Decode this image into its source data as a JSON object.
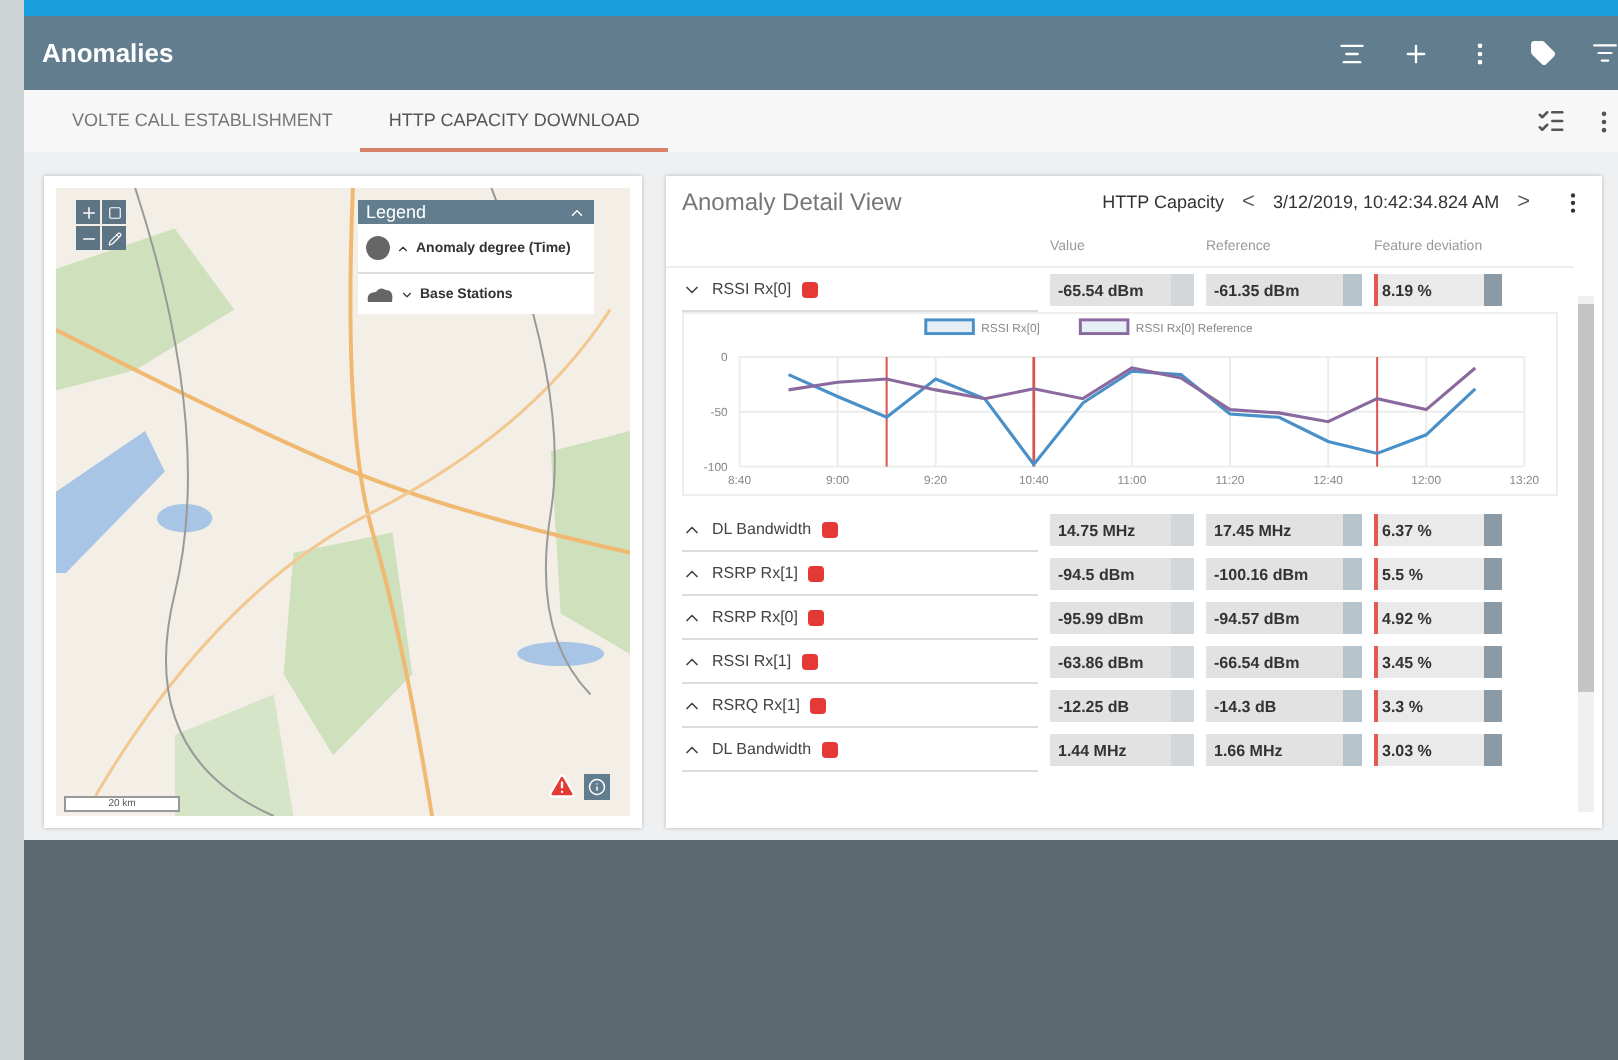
{
  "window": {
    "title": "Anomalies"
  },
  "tabs": [
    {
      "label": "VOLTE CALL ESTABLISHMENT",
      "selected": false
    },
    {
      "label": "HTTP CAPACITY DOWNLOAD",
      "selected": true
    }
  ],
  "map": {
    "legend": {
      "title": "Legend",
      "items": [
        {
          "kind": "circle",
          "label": "Anomaly degree (Time)",
          "expanded": true
        },
        {
          "kind": "cloud",
          "label": "Base Stations",
          "expanded": false
        }
      ]
    },
    "scale": "20 km"
  },
  "detail": {
    "title": "Anomaly Detail View",
    "test": "HTTP Capacity",
    "prev": "<",
    "timestamp": "3/12/2019, 10:42:34.824 AM",
    "next": ">",
    "columns": [
      "Value",
      "Reference",
      "Feature deviation"
    ],
    "rows": [
      {
        "name": "RSSI Rx[0]",
        "expanded": true,
        "value": "-65.54 dBm",
        "reference": "-61.35 dBm",
        "deviation": "8.19 %",
        "chart_data": {
          "type": "line",
          "categories": [
            "8:40",
            null,
            "9:00",
            null,
            "9:20",
            null,
            "10:40",
            null,
            "11:00",
            null,
            "11:20",
            null,
            "12:40",
            null,
            "12:00",
            null,
            "13:20"
          ],
          "ylim": [
            -100,
            0
          ],
          "yticks": [
            0,
            -50,
            -100
          ],
          "series": [
            {
              "name": "RSSI Rx[0]",
              "color": "#4a90c8",
              "values": [
                null,
                -16,
                -36,
                -55,
                -20,
                -38,
                -98,
                -42,
                -13,
                -16,
                -52,
                -55,
                -77,
                -88,
                -71,
                -29,
                null
              ]
            },
            {
              "name": "RSSI Rx[0] Reference",
              "color": "#8a6a9e",
              "values": [
                null,
                -30,
                -23,
                -20,
                -30,
                -38,
                -29,
                -38,
                -10,
                -19,
                -48,
                -51,
                -59,
                -38,
                -48,
                -10,
                null
              ]
            }
          ],
          "grid": true,
          "legend": true,
          "ref_lines": [
            {
              "axis": "x",
              "value": "10:40"
            }
          ]
        }
      },
      {
        "name": "DL Bandwidth",
        "expanded": false,
        "value": "14.75 MHz",
        "reference": "17.45 MHz",
        "deviation": "6.37 %"
      },
      {
        "name": "RSRP Rx[1]",
        "expanded": false,
        "value": "-94.5 dBm",
        "reference": "-100.16 dBm",
        "deviation": "5.5 %"
      },
      {
        "name": "RSRP Rx[0]",
        "expanded": false,
        "value": "-95.99 dBm",
        "reference": "-94.57 dBm",
        "deviation": "4.92 %"
      },
      {
        "name": "RSSI Rx[1]",
        "expanded": false,
        "value": "-63.86 dBm",
        "reference": "-66.54 dBm",
        "deviation": "3.45 %"
      },
      {
        "name": "RSRQ Rx[1]",
        "expanded": false,
        "value": "-12.25 dB",
        "reference": "-14.3 dB",
        "deviation": "3.3 %"
      },
      {
        "name": "DL Bandwidth",
        "expanded": false,
        "value": "1.44 MHz",
        "reference": "1.66 MHz",
        "deviation": "3.03 %"
      }
    ]
  }
}
